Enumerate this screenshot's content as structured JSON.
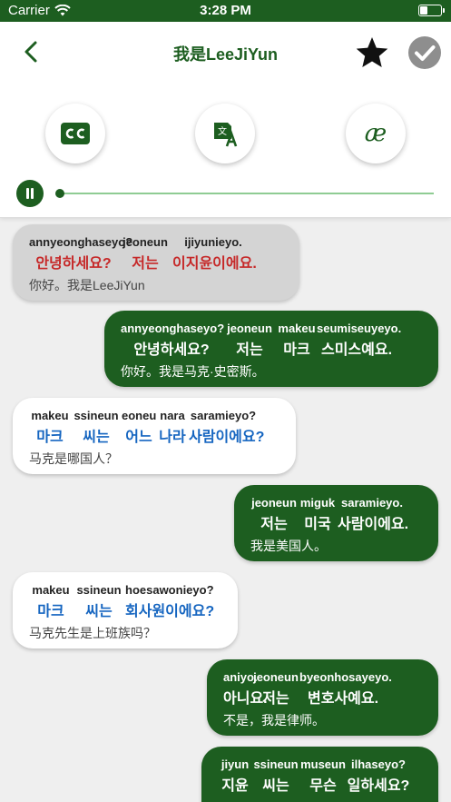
{
  "status": {
    "carrier": "Carrier",
    "time": "3:28 PM"
  },
  "header": {
    "title": "我是LeeJiYun"
  },
  "tools": [
    {
      "name": "captions",
      "icon": "cc-icon"
    },
    {
      "name": "translate",
      "icon": "translate-icon"
    },
    {
      "name": "pronunciation",
      "icon": "ae-icon",
      "glyph": "æ"
    }
  ],
  "player": {
    "progress": 0.0
  },
  "colors": {
    "brand": "#1d5e20",
    "highlight": "#c62828",
    "korean": "#1565c0",
    "track": "#8fcc93"
  },
  "messages": [
    {
      "side": "left",
      "active": true,
      "words": [
        {
          "rom": "annyeonghaseyo?",
          "kor": "안녕하세요?"
        },
        {
          "rom": "jeoneun",
          "kor": "저는"
        },
        {
          "rom": "ijiyunieyo.",
          "kor": "이지윤이에요."
        }
      ],
      "translation": "你好。我是LeeJiYun"
    },
    {
      "side": "right",
      "words": [
        {
          "rom": "annyeonghaseyo?",
          "kor": "안녕하세요?"
        },
        {
          "rom": "jeoneun",
          "kor": "저는"
        },
        {
          "rom": "makeu",
          "kor": "마크"
        },
        {
          "rom": "seumiseuyeyo.",
          "kor": "스미스예요."
        }
      ],
      "translation": "你好。我是马克·史密斯。"
    },
    {
      "side": "left",
      "words": [
        {
          "rom": "makeu",
          "kor": "마크"
        },
        {
          "rom": "ssineun",
          "kor": "씨는"
        },
        {
          "rom": "eoneu",
          "kor": "어느"
        },
        {
          "rom": "nara",
          "kor": "나라"
        },
        {
          "rom": "saramieyo?",
          "kor": "사람이에요?"
        }
      ],
      "translation": "马克是哪国人？"
    },
    {
      "side": "right",
      "words": [
        {
          "rom": "jeoneun",
          "kor": "저는"
        },
        {
          "rom": "miguk",
          "kor": "미국"
        },
        {
          "rom": "saramieyo.",
          "kor": "사람이에요."
        }
      ],
      "translation": "我是美国人。"
    },
    {
      "side": "left",
      "words": [
        {
          "rom": "makeu",
          "kor": "마크"
        },
        {
          "rom": "ssineun",
          "kor": "씨는"
        },
        {
          "rom": "hoesawonieyo?",
          "kor": "회사원이에요?"
        }
      ],
      "translation": "马克先生是上班族吗？"
    },
    {
      "side": "right",
      "words": [
        {
          "rom": "aniyo.",
          "kor": "아니요."
        },
        {
          "rom": "jeoneun",
          "kor": "저는"
        },
        {
          "rom": "byeonhosayeyo.",
          "kor": "변호사예요."
        }
      ],
      "translation": "不是，我是律师。"
    },
    {
      "side": "right",
      "words": [
        {
          "rom": "jiyun",
          "kor": "지윤"
        },
        {
          "rom": "ssineun",
          "kor": "씨는"
        },
        {
          "rom": "museun",
          "kor": "무슨"
        },
        {
          "rom": "ilhaseyo?",
          "kor": "일하세요?"
        }
      ],
      "translation": ""
    }
  ]
}
